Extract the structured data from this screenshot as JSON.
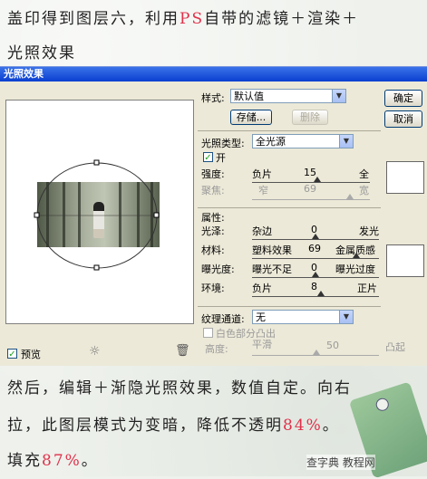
{
  "header": {
    "line1_prefix": "盖印得到图层六，利用",
    "line1_ps": "PS",
    "line1_suffix": "自带的滤镜＋渲染＋",
    "line2": "光照效果"
  },
  "dialog": {
    "title": "光照效果",
    "style_label": "样式:",
    "style_value": "默认值",
    "save_label": "存储...",
    "delete_label": "删除",
    "ok_label": "确定",
    "cancel_label": "取消",
    "light_type_label": "光照类型:",
    "light_type_value": "全光源",
    "on_label": "开",
    "intensity_label": "强度:",
    "intensity_left": "负片",
    "intensity_value": "15",
    "intensity_right": "全",
    "focus_label": "聚焦:",
    "focus_left": "窄",
    "focus_value": "69",
    "focus_right": "宽",
    "properties_label": "属性:",
    "gloss_label": "光泽:",
    "gloss_left": "杂边",
    "gloss_value": "0",
    "gloss_right": "发光",
    "material_label": "材料:",
    "material_left": "塑料效果",
    "material_value": "69",
    "material_right": "金属质感",
    "exposure_label": "曝光度:",
    "exposure_left": "曝光不足",
    "exposure_value": "0",
    "exposure_right": "曝光过度",
    "ambience_label": "环境:",
    "ambience_left": "负片",
    "ambience_value": "8",
    "ambience_right": "正片",
    "texture_label": "纹理通道:",
    "texture_value": "无",
    "white_high_label": "白色部分凸出",
    "height_label": "高度:",
    "height_left": "平滑",
    "height_value": "50",
    "height_right": "凸起",
    "preview_label": "预览"
  },
  "footer": {
    "line1": "然后，编辑＋渐隐光照效果，数值自定。向右",
    "line2_prefix": "拉，此图层模式为变暗，降低不透明",
    "line2_value": "84%",
    "line2_end": "。",
    "line3_prefix": "填充",
    "line3_value": "87%",
    "line3_end": "。",
    "watermark": "查字典 教程网"
  },
  "colors": {
    "accent_red": "#e0304a",
    "title_blue": "#0a3fd1"
  }
}
